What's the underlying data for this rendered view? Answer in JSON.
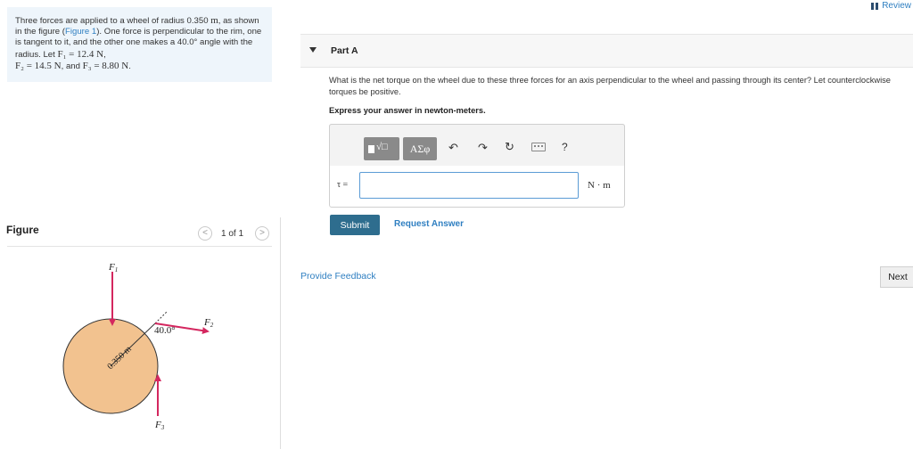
{
  "problem": {
    "text_1": "Three forces are applied to a wheel of radius 0.350 ",
    "radius_unit": "m",
    "text_2": ", as shown in the figure (",
    "figure_link": "Figure 1",
    "text_3": "). One force is perpendicular to the rim, one is tangent to it, and the other one makes a 40.0° angle with the radius. Let ",
    "f1_eq": "F₁ = 12.4 N",
    "sep_1": ",",
    "f2_eq": "F₂ = 14.5 N",
    "sep_2": ", and ",
    "f3_eq": "F₃ = 8.80 N",
    "end": "."
  },
  "figure_panel": {
    "label": "Figure",
    "prev_icon": "chevron-left-icon",
    "next_icon": "chevron-right-icon",
    "prev_glyph": "<",
    "next_glyph": ">",
    "counter": "1 of 1"
  },
  "figure": {
    "f1_label": "F",
    "f1_sub": "1",
    "f2_label": "F",
    "f2_sub": "2",
    "f3_label": "F",
    "f3_sub": "3",
    "angle_label": "40.0°",
    "radius_label": "0.350 m",
    "wheel_color": "#f2c28f",
    "arrow_color": "#d4275f"
  },
  "header": {
    "review_label": "Review",
    "review_icon": "review-bars-icon"
  },
  "part_a": {
    "title": "Part A",
    "question": "What is the net torque on the wheel due to these three forces for an axis perpendicular to the wheel and passing through its center? Let counterclockwise torques be positive.",
    "instruction": "Express your answer in newton-meters.",
    "toolbar": {
      "templates_icon": "templates-icon",
      "templates_glyph": "√□",
      "greek_label": "ΑΣφ",
      "undo_glyph": "↶",
      "redo_glyph": "↷",
      "reset_glyph": "↻",
      "help_label": "?"
    },
    "answer_label": "τ =",
    "answer_value": "",
    "unit": "N · m",
    "submit_label": "Submit",
    "request_answer_label": "Request Answer"
  },
  "footer": {
    "feedback_label": "Provide Feedback",
    "next_label": "Next"
  }
}
